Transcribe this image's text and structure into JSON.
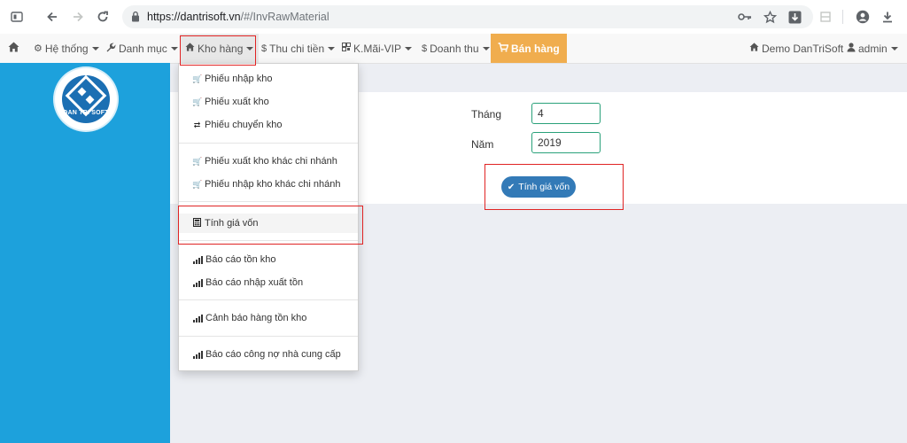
{
  "browser": {
    "url_host": "https://dantrisoft.vn",
    "url_path": "/#/InvRawMaterial"
  },
  "navbar": {
    "home_icon": "home-icon",
    "items": [
      {
        "label": "Hệ thống",
        "icon": "gear-icon"
      },
      {
        "label": "Danh mục",
        "icon": "wrench-icon"
      },
      {
        "label": "Kho hàng",
        "icon": "home-icon"
      },
      {
        "label": "Thu chi tiền",
        "icon": "dollar-icon"
      },
      {
        "label": "K.Mãi-VIP",
        "icon": "qrcode-icon"
      },
      {
        "label": "Doanh thu",
        "icon": "dollar-icon"
      }
    ],
    "sell_label": "Bán hàng",
    "company_label": "Demo DanTriSoft",
    "user_label": "admin"
  },
  "logo": {
    "brand": "DAN TRI SOFT"
  },
  "dropdown": {
    "items": [
      {
        "label": "Phiếu nhập kho",
        "icon": "basket-icon"
      },
      {
        "label": "Phiếu xuất kho",
        "icon": "basket-icon"
      },
      {
        "label": "Phiếu chuyển kho",
        "icon": "transfer-icon"
      },
      {
        "label": "Phiếu xuất kho khác chi nhánh",
        "icon": "basket-icon"
      },
      {
        "label": "Phiếu nhập kho khác chi nhánh",
        "icon": "basket-icon"
      },
      {
        "label": "Tính giá vốn",
        "icon": "calculator-icon"
      },
      {
        "label": "Báo cáo tồn kho",
        "icon": "signal-icon"
      },
      {
        "label": "Báo cáo nhập xuất tồn",
        "icon": "signal-icon"
      },
      {
        "label": "Cảnh báo hàng tồn kho",
        "icon": "signal-icon"
      },
      {
        "label": "Báo cáo công nợ nhà cung cấp",
        "icon": "signal-icon"
      }
    ]
  },
  "form": {
    "month_label": "Tháng",
    "month_value": "4",
    "year_label": "Năm",
    "year_value": "2019",
    "submit_label": "Tính giá vốn"
  },
  "colors": {
    "sidebar": "#1da1dc",
    "sell": "#f0ad4e",
    "button": "#337ab7",
    "highlight": "#e02424"
  }
}
